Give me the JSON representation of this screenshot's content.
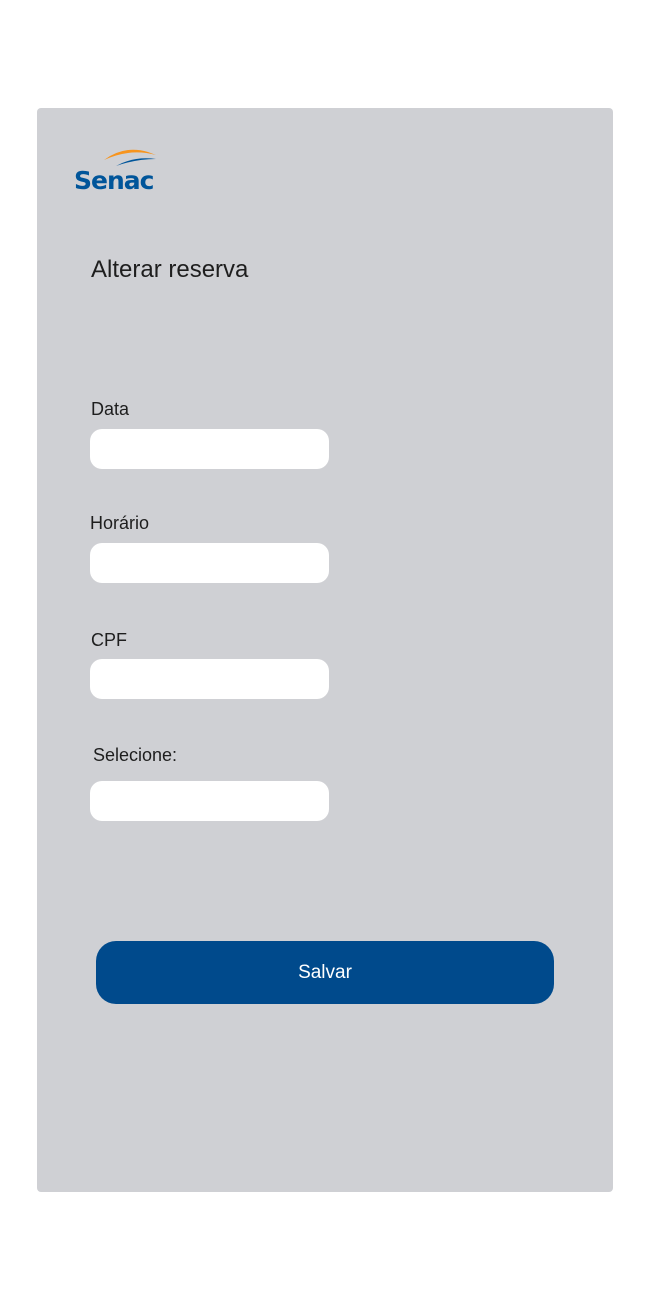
{
  "brand": {
    "logo_text": "Senac",
    "colors": {
      "blue": "#00559a",
      "orange": "#f7941d"
    }
  },
  "form": {
    "title": "Alterar reserva",
    "fields": [
      {
        "label": "Data",
        "value": "",
        "placeholder": ""
      },
      {
        "label": "Horário",
        "value": "",
        "placeholder": ""
      },
      {
        "label": "CPF",
        "value": "",
        "placeholder": ""
      },
      {
        "label": "Selecione:",
        "value": "",
        "placeholder": ""
      }
    ],
    "save_label": "Salvar"
  },
  "colors": {
    "card_background": "#cfd0d4",
    "button_background": "#004a8c"
  }
}
